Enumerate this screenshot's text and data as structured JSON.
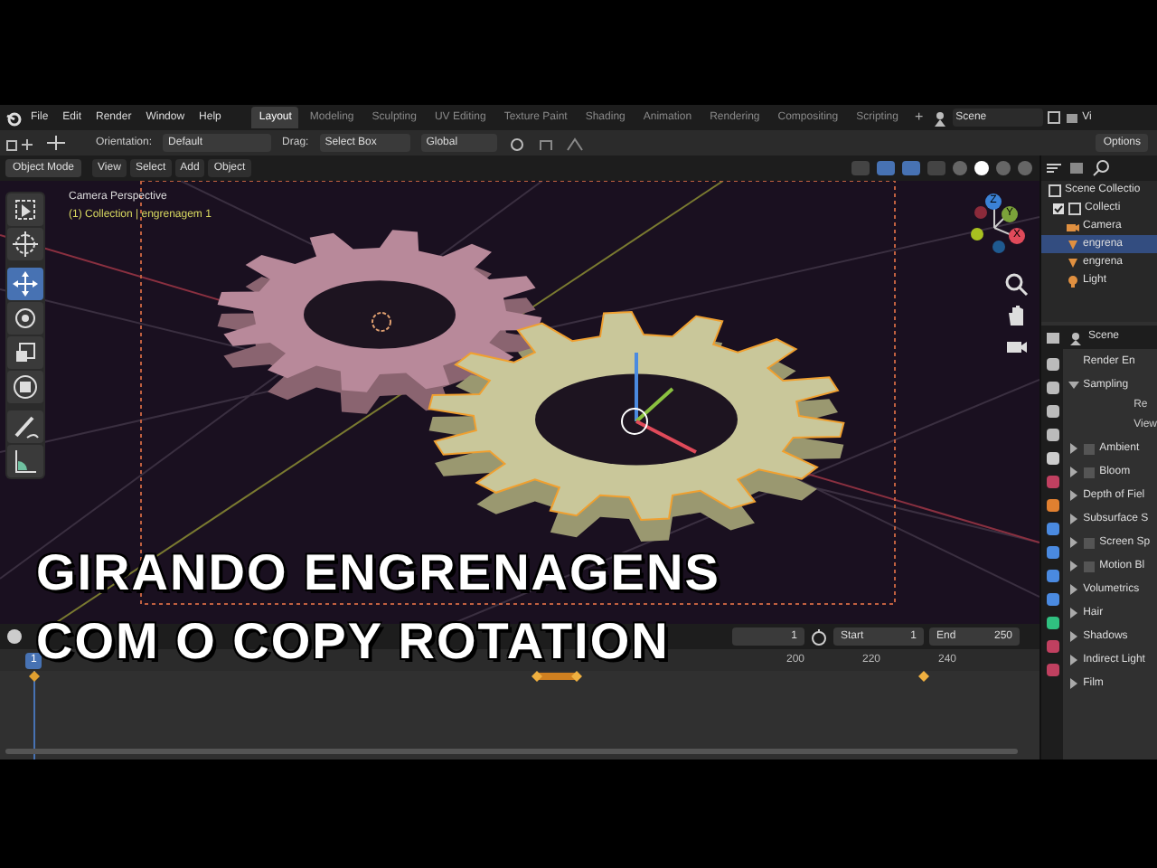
{
  "topbar": {
    "menus": [
      "File",
      "Edit",
      "Render",
      "Window",
      "Help"
    ],
    "workspaces": [
      {
        "label": "Layout",
        "selected": true
      },
      {
        "label": "Modeling",
        "selected": false
      },
      {
        "label": "Sculpting",
        "selected": false
      },
      {
        "label": "UV Editing",
        "selected": false
      },
      {
        "label": "Texture Paint",
        "selected": false
      },
      {
        "label": "Shading",
        "selected": false
      },
      {
        "label": "Animation",
        "selected": false
      },
      {
        "label": "Rendering",
        "selected": false
      },
      {
        "label": "Compositing",
        "selected": false
      },
      {
        "label": "Scripting",
        "selected": false
      }
    ],
    "add_tab": "+",
    "scene": "Scene",
    "view_layer": "Vi"
  },
  "tool_header": {
    "orientation_label": "Orientation:",
    "orientation": "Default",
    "drag_label": "Drag:",
    "drag": "Select Box",
    "transform": "Global",
    "options": "Options"
  },
  "viewport": {
    "mode": "Object Mode",
    "menus": [
      "View",
      "Select",
      "Add",
      "Object"
    ],
    "camera_label": "Camera Perspective",
    "object_label": "(1) Collection | engrenagem 1",
    "tools": [
      {
        "kind": "select",
        "selected": false
      },
      {
        "kind": "cursor",
        "selected": false
      },
      {
        "kind": "move",
        "selected": true
      },
      {
        "kind": "rotate",
        "selected": false
      },
      {
        "kind": "scale",
        "selected": false
      },
      {
        "kind": "transform",
        "selected": false
      },
      {
        "kind": "annotate",
        "selected": false
      },
      {
        "kind": "measure",
        "selected": false
      }
    ],
    "gizmo_axes": [
      "Z",
      "Y",
      "X"
    ]
  },
  "title_overlay": [
    "GIRANDO ENGRENAGENS",
    "COM O COPY ROTATION"
  ],
  "timeline": {
    "current_frame": "1",
    "frame_field": "1",
    "start_label": "Start",
    "start": "1",
    "end_label": "End",
    "end": "250",
    "ruler": [
      "200",
      "220",
      "240"
    ]
  },
  "outliner": {
    "header": "Scene Collectio",
    "items": [
      {
        "label": "Collecti",
        "kind": "collection",
        "checked": true,
        "selected": false,
        "children": [
          {
            "label": "Camera",
            "kind": "camera",
            "selected": false
          },
          {
            "label": "engrena",
            "kind": "mesh",
            "selected": true
          },
          {
            "label": "engrena",
            "kind": "mesh",
            "selected": false
          },
          {
            "label": "Light",
            "kind": "light",
            "selected": false
          }
        ]
      }
    ]
  },
  "properties": {
    "scene": "Scene",
    "render_engine": "Render En",
    "sections": [
      {
        "label": "Sampling",
        "kind": "panel",
        "expanded": true,
        "fields": [
          "Re",
          "View"
        ]
      },
      {
        "label": "Ambient",
        "kind": "toggle",
        "checked": false,
        "expanded": false
      },
      {
        "label": "Bloom",
        "kind": "toggle",
        "checked": false,
        "expanded": false
      },
      {
        "label": "Depth of Fiel",
        "kind": "panel",
        "expanded": false
      },
      {
        "label": "Subsurface S",
        "kind": "panel",
        "expanded": false
      },
      {
        "label": "Screen Sp",
        "kind": "toggle",
        "checked": false,
        "expanded": false
      },
      {
        "label": "Motion Bl",
        "kind": "toggle",
        "checked": false,
        "expanded": false
      },
      {
        "label": "Volumetrics",
        "kind": "panel",
        "expanded": false
      },
      {
        "label": "Hair",
        "kind": "panel",
        "expanded": false
      },
      {
        "label": "Shadows",
        "kind": "panel",
        "expanded": false
      },
      {
        "label": "Indirect Light",
        "kind": "panel",
        "expanded": false
      },
      {
        "label": "Film",
        "kind": "panel",
        "expanded": false
      }
    ]
  }
}
